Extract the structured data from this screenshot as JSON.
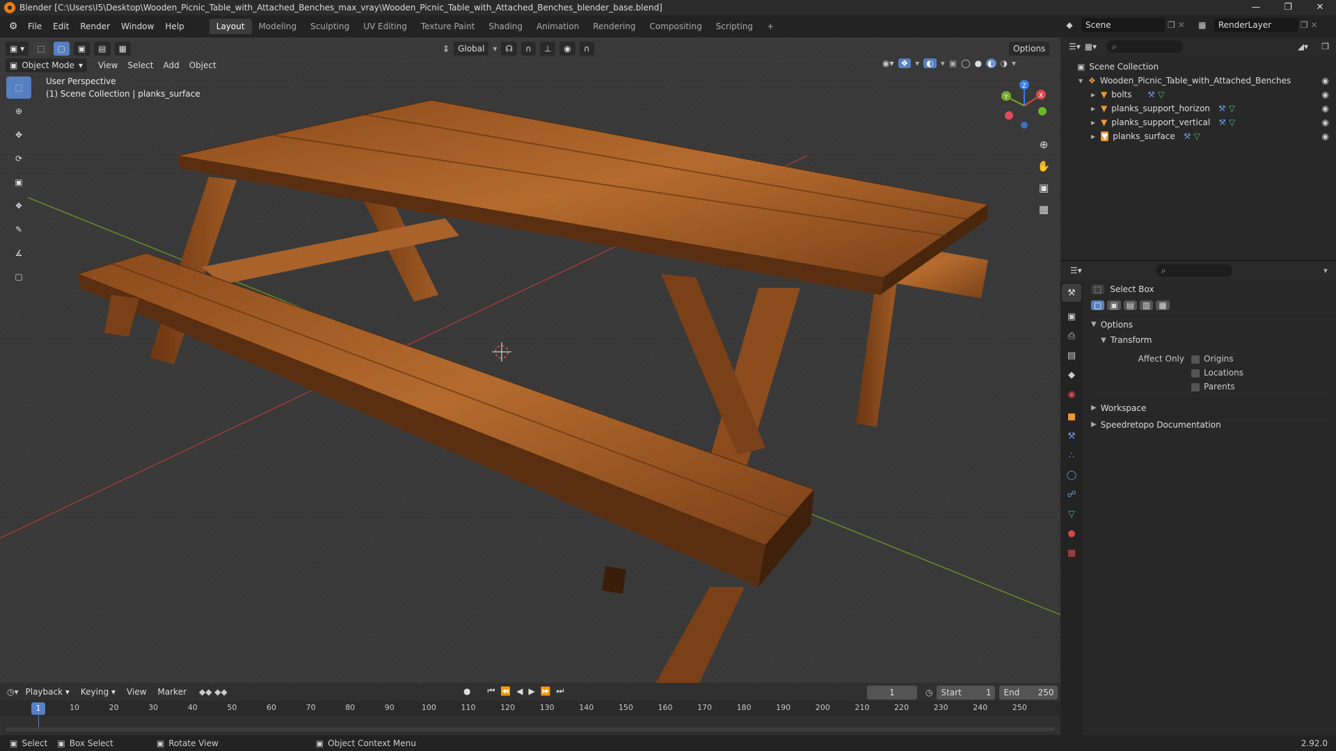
{
  "window": {
    "title": "Blender [C:\\Users\\I5\\Desktop\\Wooden_Picnic_Table_with_Attached_Benches_max_vray\\Wooden_Picnic_Table_with_Attached_Benches_blender_base.blend]",
    "minimize": "—",
    "maximize": "❐",
    "close": "✕"
  },
  "menu": [
    "File",
    "Edit",
    "Render",
    "Window",
    "Help"
  ],
  "workspaces": [
    "Layout",
    "Modeling",
    "Sculpting",
    "UV Editing",
    "Texture Paint",
    "Shading",
    "Animation",
    "Rendering",
    "Compositing",
    "Scripting"
  ],
  "active_workspace": "Layout",
  "scene": {
    "name": "Scene",
    "render_layer": "RenderLayer"
  },
  "viewport": {
    "mode": "Object Mode",
    "menus": [
      "View",
      "Select",
      "Add",
      "Object"
    ],
    "orientation": "Global",
    "options_label": "Options",
    "perspective": "User Perspective",
    "collection_info": "(1) Scene Collection | planks_surface",
    "gizmo_labels": {
      "z": "Z",
      "y": "Y",
      "x": "X"
    }
  },
  "outliner": {
    "root": "Scene Collection",
    "collection": "Wooden_Picnic_Table_with_Attached_Benches",
    "items": [
      "bolts",
      "planks_support_horizon",
      "planks_support_vertical",
      "planks_surface"
    ]
  },
  "properties": {
    "tool_name": "Select Box",
    "options_label": "Options",
    "transform_label": "Transform",
    "affect_only_label": "Affect Only",
    "checkboxes": [
      "Origins",
      "Locations",
      "Parents"
    ],
    "workspace_label": "Workspace",
    "speedretopo_label": "Speedretopo Documentation"
  },
  "timeline": {
    "menus": [
      "Playback",
      "Keying",
      "View",
      "Marker"
    ],
    "current_frame": "1",
    "start_label": "Start",
    "start_value": "1",
    "end_label": "End",
    "end_value": "250",
    "ruler": [
      "10",
      "20",
      "30",
      "40",
      "50",
      "60",
      "70",
      "80",
      "90",
      "100",
      "110",
      "120",
      "130",
      "140",
      "150",
      "160",
      "170",
      "180",
      "190",
      "200",
      "210",
      "220",
      "230",
      "240",
      "250"
    ],
    "playhead_label": "1"
  },
  "statusbar": {
    "select": "Select",
    "box_select": "Box Select",
    "rotate_view": "Rotate View",
    "context_menu": "Object Context Menu",
    "version": "2.92.0"
  },
  "colors": {
    "accent": "#5680c2",
    "wood_dark": "#6b3a16",
    "wood_light": "#b76a2c"
  }
}
